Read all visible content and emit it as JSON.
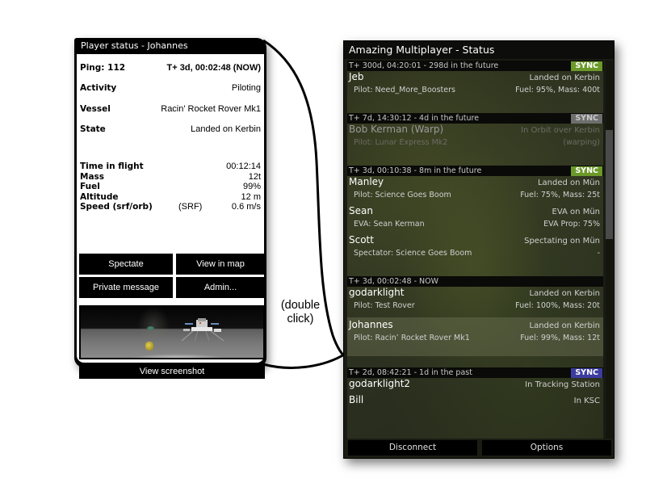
{
  "player_status": {
    "title": "Player status - Johannes",
    "ping_label": "Ping: 112",
    "time": "T+ 3d, 00:02:48 (NOW)",
    "fields": [
      {
        "key": "Activity",
        "value": "Piloting"
      },
      {
        "key": "Vessel",
        "value": "Racin' Rocket Rover Mk1"
      },
      {
        "key": "State",
        "value": "Landed on Kerbin"
      }
    ],
    "stats": [
      {
        "key": "Time in flight",
        "mid": "",
        "value": "00:12:14"
      },
      {
        "key": "Mass",
        "mid": "",
        "value": "12t"
      },
      {
        "key": "Fuel",
        "mid": "",
        "value": "99%"
      },
      {
        "key": "Altitude",
        "mid": "",
        "value": "12 m"
      },
      {
        "key": "Speed (srf/orb)",
        "mid": "(SRF)",
        "value": "0.6 m/s"
      }
    ],
    "buttons": {
      "spectate": "Spectate",
      "view_in_map": "View in map",
      "private_message": "Private message",
      "admin": "Admin..."
    },
    "view_screenshot": "View screenshot"
  },
  "caption": {
    "line1": "(double",
    "line2": "click)"
  },
  "multiplayer_status": {
    "title": "Amazing Multiplayer - Status",
    "colors": {
      "sync_green": "#6c9a2a",
      "sync_gray": "#6e6e6e",
      "sync_blue": "#3c3ca0"
    },
    "groups": [
      {
        "header": "T+ 300d, 04:20:01 - 298d in the future",
        "sync": {
          "label": "SYNC",
          "state": "green"
        },
        "players": [
          {
            "name": "Jeb",
            "state": "Landed on Kerbin",
            "sub": "Pilot: Need_More_Boosters",
            "detail": "Fuel: 95%, Mass: 400t"
          }
        ]
      },
      {
        "header": "T+ 7d, 14:30:12 - 4d in the future",
        "sync": {
          "label": "SYNC",
          "state": "gray"
        },
        "players": [
          {
            "name": "Bob Kerman (Warp)",
            "state": "In Orbit over Kerbin",
            "sub": "Pilot: Lunar Express Mk2",
            "detail": "(warping)"
          }
        ]
      },
      {
        "header": "T+ 3d, 00:10:38 - 8m in the future",
        "sync": {
          "label": "SYNC",
          "state": "green"
        },
        "players": [
          {
            "name": "Manley",
            "state": "Landed on Mün",
            "sub": "Pilot: Science Goes Boom",
            "detail": "Fuel: 75%, Mass: 25t"
          },
          {
            "name": "Sean",
            "state": "EVA on Mün",
            "sub": "EVA: Sean Kerman",
            "detail": "EVA Prop: 75%"
          },
          {
            "name": "Scott",
            "state": "Spectating on Mün",
            "sub": "Spectator: Science Goes Boom",
            "detail": "-"
          }
        ]
      },
      {
        "header": "T+ 3d, 00:02:48 - NOW",
        "sync": null,
        "players": [
          {
            "name": "godarklight",
            "state": "Landed on Kerbin",
            "sub": "Pilot: Test Rover",
            "detail": "Fuel: 100%, Mass: 20t"
          },
          {
            "name": "Johannes",
            "state": "Landed on Kerbin",
            "sub": "Pilot: Racin’ Rocket Rover Mk1",
            "detail": "Fuel: 99%, Mass: 12t",
            "selected": true
          }
        ]
      },
      {
        "header": "T+ 2d, 08:42:21 - 1d in the past",
        "sync": {
          "label": "SYNC",
          "state": "blue"
        },
        "players": [
          {
            "name": "godarklight2",
            "state": "In Tracking Station"
          },
          {
            "name": "Bill",
            "state": "In KSC"
          }
        ]
      }
    ],
    "footer": {
      "disconnect": "Disconnect",
      "options": "Options"
    }
  }
}
